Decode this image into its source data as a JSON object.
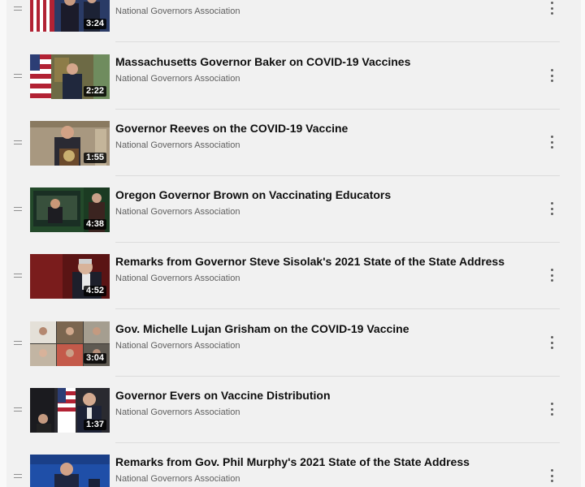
{
  "playlist": {
    "items": [
      {
        "title": "",
        "channel": "National Governors Association",
        "duration": "3:24",
        "thumb": "flag"
      },
      {
        "title": "Massachusetts Governor Baker on COVID-19 Vaccines",
        "channel": "National Governors Association",
        "duration": "2:22",
        "thumb": "flag"
      },
      {
        "title": "Governor Reeves on the COVID-19 Vaccine",
        "channel": "National Governors Association",
        "duration": "1:55",
        "thumb": "podium"
      },
      {
        "title": "Oregon Governor Brown on Vaccinating Educators",
        "channel": "National Governors Association",
        "duration": "4:38",
        "thumb": "green"
      },
      {
        "title": "Remarks from Governor Steve Sisolak's 2021 State of the State Address",
        "channel": "National Governors Association",
        "duration": "4:52",
        "thumb": "red"
      },
      {
        "title": "Gov. Michelle Lujan Grisham on the COVID-19 Vaccine",
        "channel": "National Governors Association",
        "duration": "3:04",
        "thumb": "grid"
      },
      {
        "title": "Governor Evers on Vaccine Distribution",
        "channel": "National Governors Association",
        "duration": "1:37",
        "thumb": "flag"
      },
      {
        "title": "Remarks from Gov. Phil Murphy's 2021 State of the State Address",
        "channel": "National Governors Association",
        "duration": "",
        "thumb": "blue"
      }
    ]
  },
  "icons": {
    "drag": "drag-handle-icon",
    "more": "more-vert-icon"
  }
}
